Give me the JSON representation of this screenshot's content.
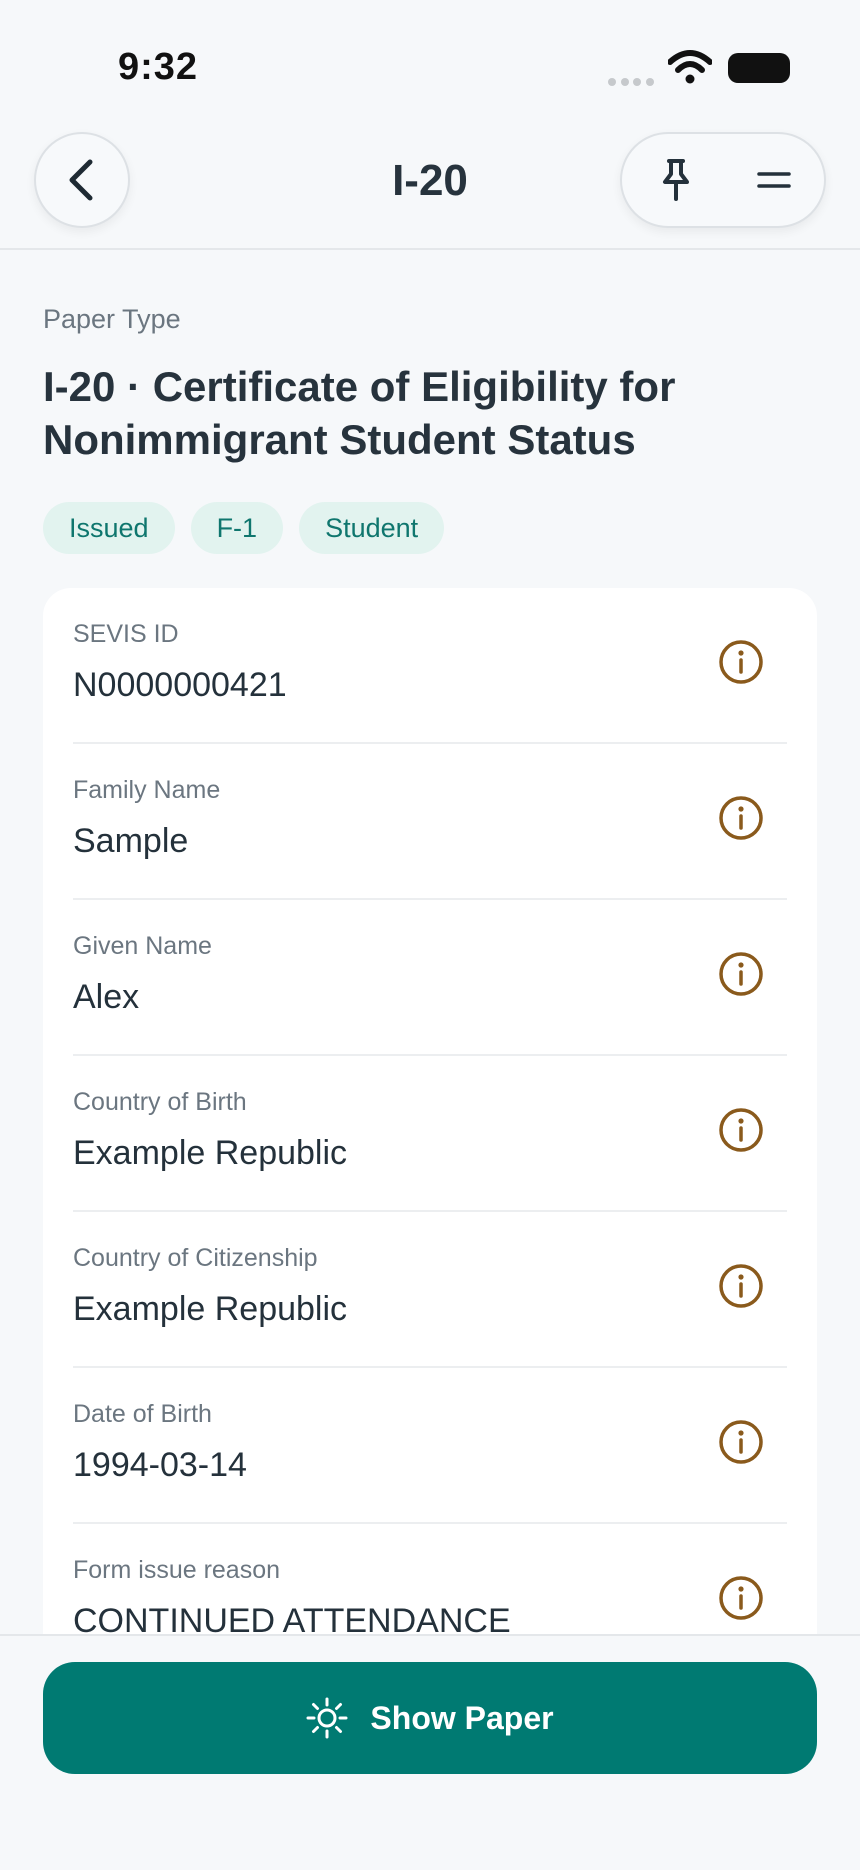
{
  "status_bar": {
    "time": "9:32"
  },
  "header": {
    "title": "I-20",
    "back_icon": "chevron-left-icon",
    "pin_icon": "pin-icon",
    "menu_icon": "menu-icon"
  },
  "paper": {
    "type_label": "Paper Type",
    "title": "I-20 · Certificate of Eligibility for Nonimmigrant Student Status",
    "tags": [
      "Issued",
      "F-1",
      "Student"
    ]
  },
  "fields": [
    {
      "label": "SEVIS ID",
      "value": "N0000000421"
    },
    {
      "label": "Family Name",
      "value": "Sample"
    },
    {
      "label": "Given Name",
      "value": "Alex"
    },
    {
      "label": "Country of Birth",
      "value": "Example Republic"
    },
    {
      "label": "Country of Citizenship",
      "value": "Example Republic"
    },
    {
      "label": "Date of Birth",
      "value": "1994-03-14"
    },
    {
      "label": "Form issue reason",
      "value": "CONTINUED ATTENDANCE"
    }
  ],
  "bottom": {
    "show_paper_label": "Show Paper",
    "show_paper_icon": "sun-icon"
  },
  "colors": {
    "accent": "#007a72",
    "tag_bg": "#e2f3ef",
    "tag_text": "#0f766e",
    "info_icon": "#8a5a1c",
    "background": "#f6f8fa"
  }
}
